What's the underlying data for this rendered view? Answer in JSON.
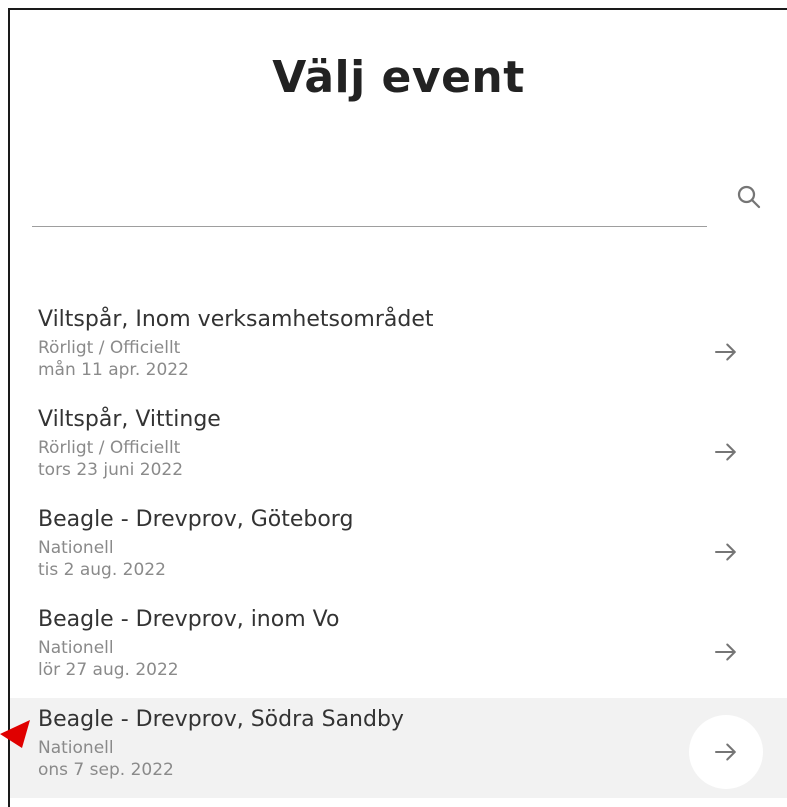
{
  "page": {
    "title": "Välj event"
  },
  "search": {
    "value": "",
    "placeholder": "",
    "icon": "search-icon"
  },
  "events": [
    {
      "name": "Viltspår, Inom verksamhetsområdet",
      "type": "Rörligt / Officiellt",
      "date": "mån 11 apr. 2022"
    },
    {
      "name": "Viltspår, Vittinge",
      "type": "Rörligt / Officiellt",
      "date": "tors 23 juni 2022"
    },
    {
      "name": "Beagle - Drevprov, Göteborg",
      "type": "Nationell",
      "date": "tis 2 aug. 2022"
    },
    {
      "name": "Beagle - Drevprov, inom Vo",
      "type": "Nationell",
      "date": "lör 27 aug. 2022"
    },
    {
      "name": "Beagle - Drevprov, Södra Sandby",
      "type": "Nationell",
      "date": "ons 7 sep. 2022"
    }
  ],
  "colors": {
    "text": "#333333",
    "muted": "#8a8a8a",
    "hover_bg": "#f2f2f2",
    "annotation_arrow": "#e00000"
  }
}
